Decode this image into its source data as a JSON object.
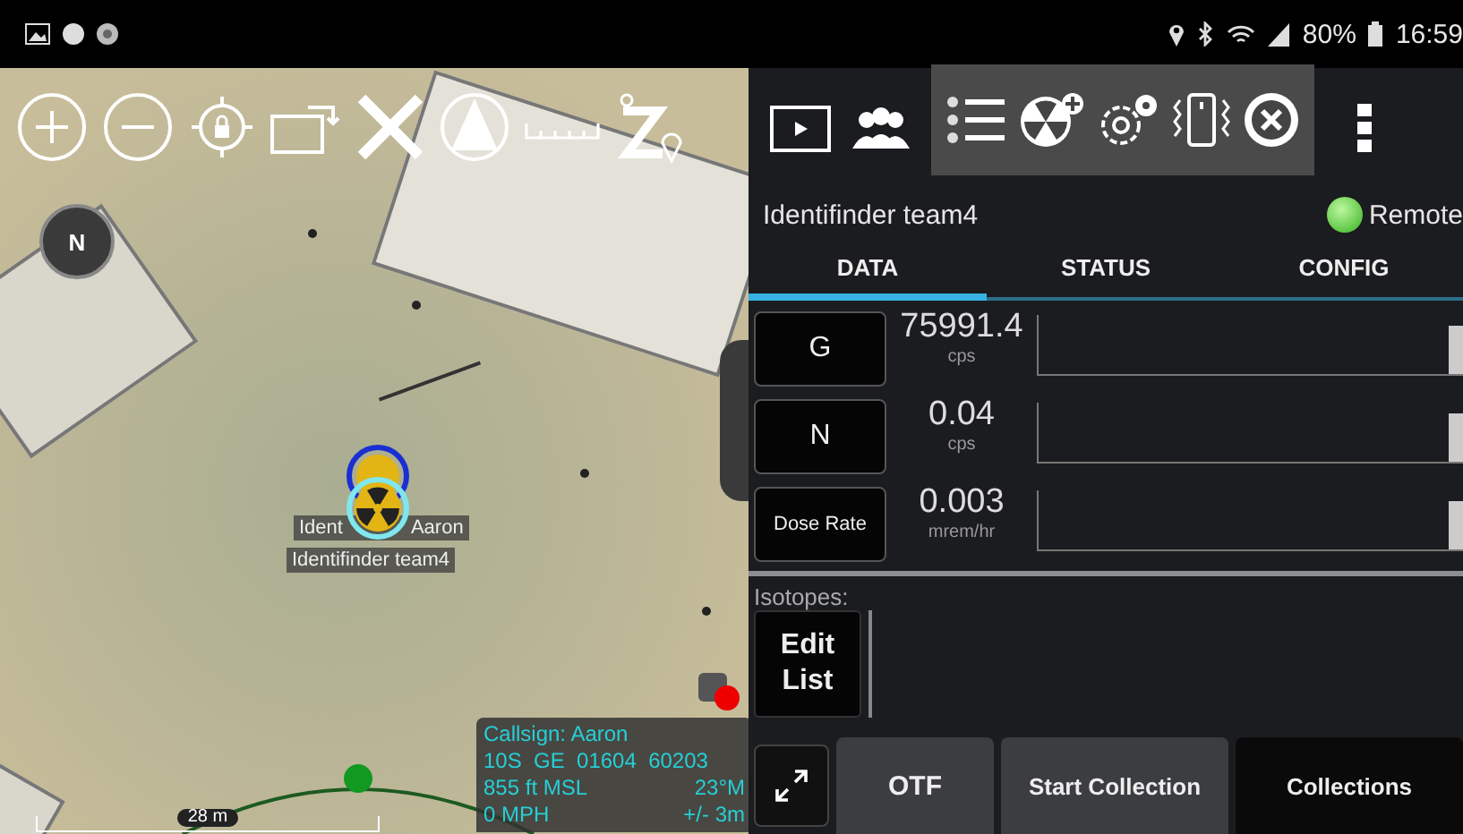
{
  "status_bar": {
    "battery": "80%",
    "time": "16:59"
  },
  "map": {
    "compass": "N",
    "marker_label": {
      "left": "Ident",
      "right": "Aaron"
    },
    "marker_name": "Identifinder team4",
    "info": {
      "callsign": "Callsign: Aaron",
      "grid": "10S  GE  01604  60203",
      "altitude": "855 ft MSL",
      "heading": "23°M",
      "speed": "0 MPH",
      "accuracy": "+/- 3m"
    },
    "scale": "28 m"
  },
  "panel": {
    "device": "Identifinder team4",
    "remote": {
      "label": "Remote",
      "connected": true
    },
    "tabs": [
      {
        "label": "DATA",
        "selected": true
      },
      {
        "label": "STATUS",
        "selected": false
      },
      {
        "label": "CONFIG",
        "selected": false
      }
    ],
    "meters": [
      {
        "name": "G",
        "value": "75991.4",
        "unit": "cps",
        "kind": "large"
      },
      {
        "name": "N",
        "value": "0.04",
        "unit": "cps",
        "kind": "large"
      },
      {
        "name": "Dose Rate",
        "value": "0.003",
        "unit": "mrem/hr",
        "kind": "small"
      }
    ],
    "isotopes_label": "Isotopes:",
    "edit_list": "Edit List",
    "buttons": [
      {
        "label": "OTF",
        "selected": false
      },
      {
        "label": "Start Collection",
        "selected": false
      },
      {
        "label": "Collections",
        "selected": true
      }
    ]
  }
}
